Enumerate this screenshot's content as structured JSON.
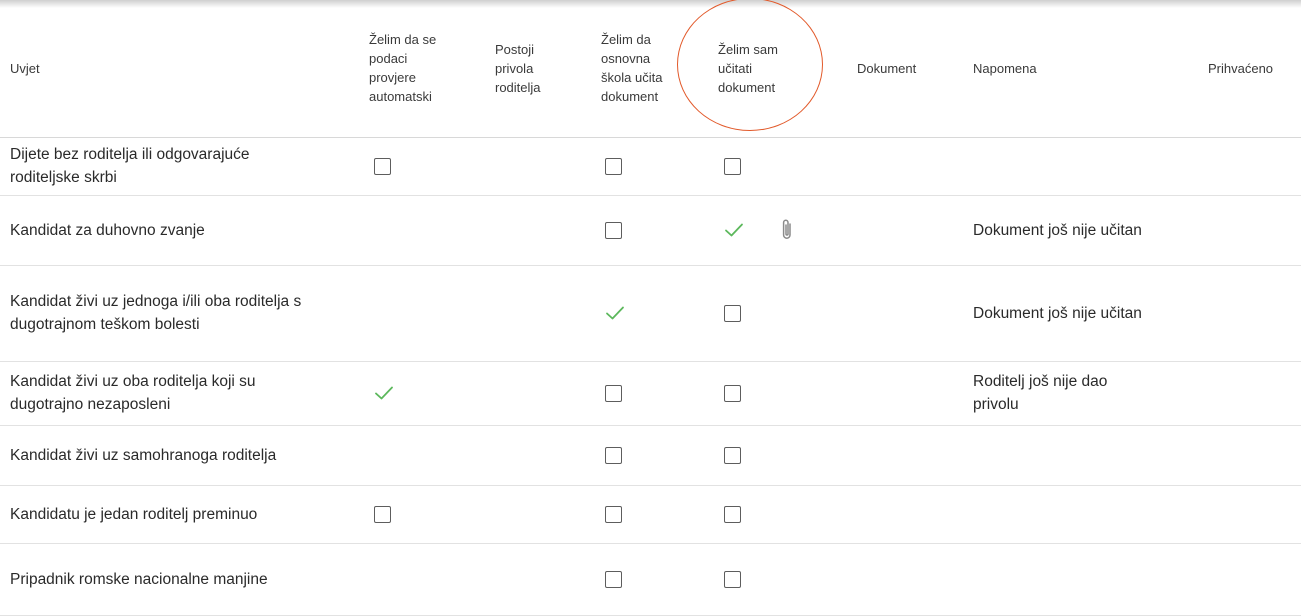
{
  "columns": {
    "condition": "Uvjet",
    "auto_check": "Želim da se podaci provjere automatski",
    "parent_consent": "Postoji privola roditelja",
    "school_uploads": "Želim da osnovna škola učita dokument",
    "self_upload": "Želim sam učitati dokument",
    "document": "Dokument",
    "note": "Napomena",
    "accepted": "Prihvaćeno"
  },
  "rows": [
    {
      "condition": "Dijete bez roditelja ili odgovarajuće roditeljske skrbi",
      "auto_check": "unchecked",
      "parent_consent": "none",
      "school_uploads": "unchecked",
      "self_upload": "unchecked",
      "attachment": false,
      "note": ""
    },
    {
      "condition": "Kandidat za duhovno zvanje",
      "auto_check": "none",
      "parent_consent": "none",
      "school_uploads": "unchecked",
      "self_upload": "checked",
      "attachment": true,
      "note": "Dokument još nije učitan"
    },
    {
      "condition": "Kandidat živi uz jednoga i/ili oba roditelja s dugotrajnom teškom bolesti",
      "auto_check": "none",
      "parent_consent": "none",
      "school_uploads": "checked",
      "self_upload": "unchecked",
      "attachment": false,
      "note": "Dokument još nije učitan"
    },
    {
      "condition": "Kandidat živi uz oba roditelja koji su dugotrajno nezaposleni",
      "auto_check": "checked",
      "parent_consent": "none",
      "school_uploads": "unchecked",
      "self_upload": "unchecked",
      "attachment": false,
      "note": "Roditelj još nije dao privolu"
    },
    {
      "condition": "Kandidat živi uz samohranoga roditelja",
      "auto_check": "none",
      "parent_consent": "none",
      "school_uploads": "unchecked",
      "self_upload": "unchecked",
      "attachment": false,
      "note": ""
    },
    {
      "condition": "Kandidatu je jedan roditelj preminuo",
      "auto_check": "unchecked",
      "parent_consent": "none",
      "school_uploads": "unchecked",
      "self_upload": "unchecked",
      "attachment": false,
      "note": ""
    },
    {
      "condition": "Pripadnik romske nacionalne manjine",
      "auto_check": "none",
      "parent_consent": "none",
      "school_uploads": "unchecked",
      "self_upload": "unchecked",
      "attachment": false,
      "note": ""
    }
  ],
  "icons": {
    "checkbox": "checkbox-empty-icon",
    "check": "checkmark-icon",
    "attachment": "paperclip-icon"
  },
  "colors": {
    "check_green": "#5cb85c",
    "highlight_orange": "#e25a2b",
    "text": "#2a2a2a",
    "checkbox_border": "#5d5d5d"
  }
}
